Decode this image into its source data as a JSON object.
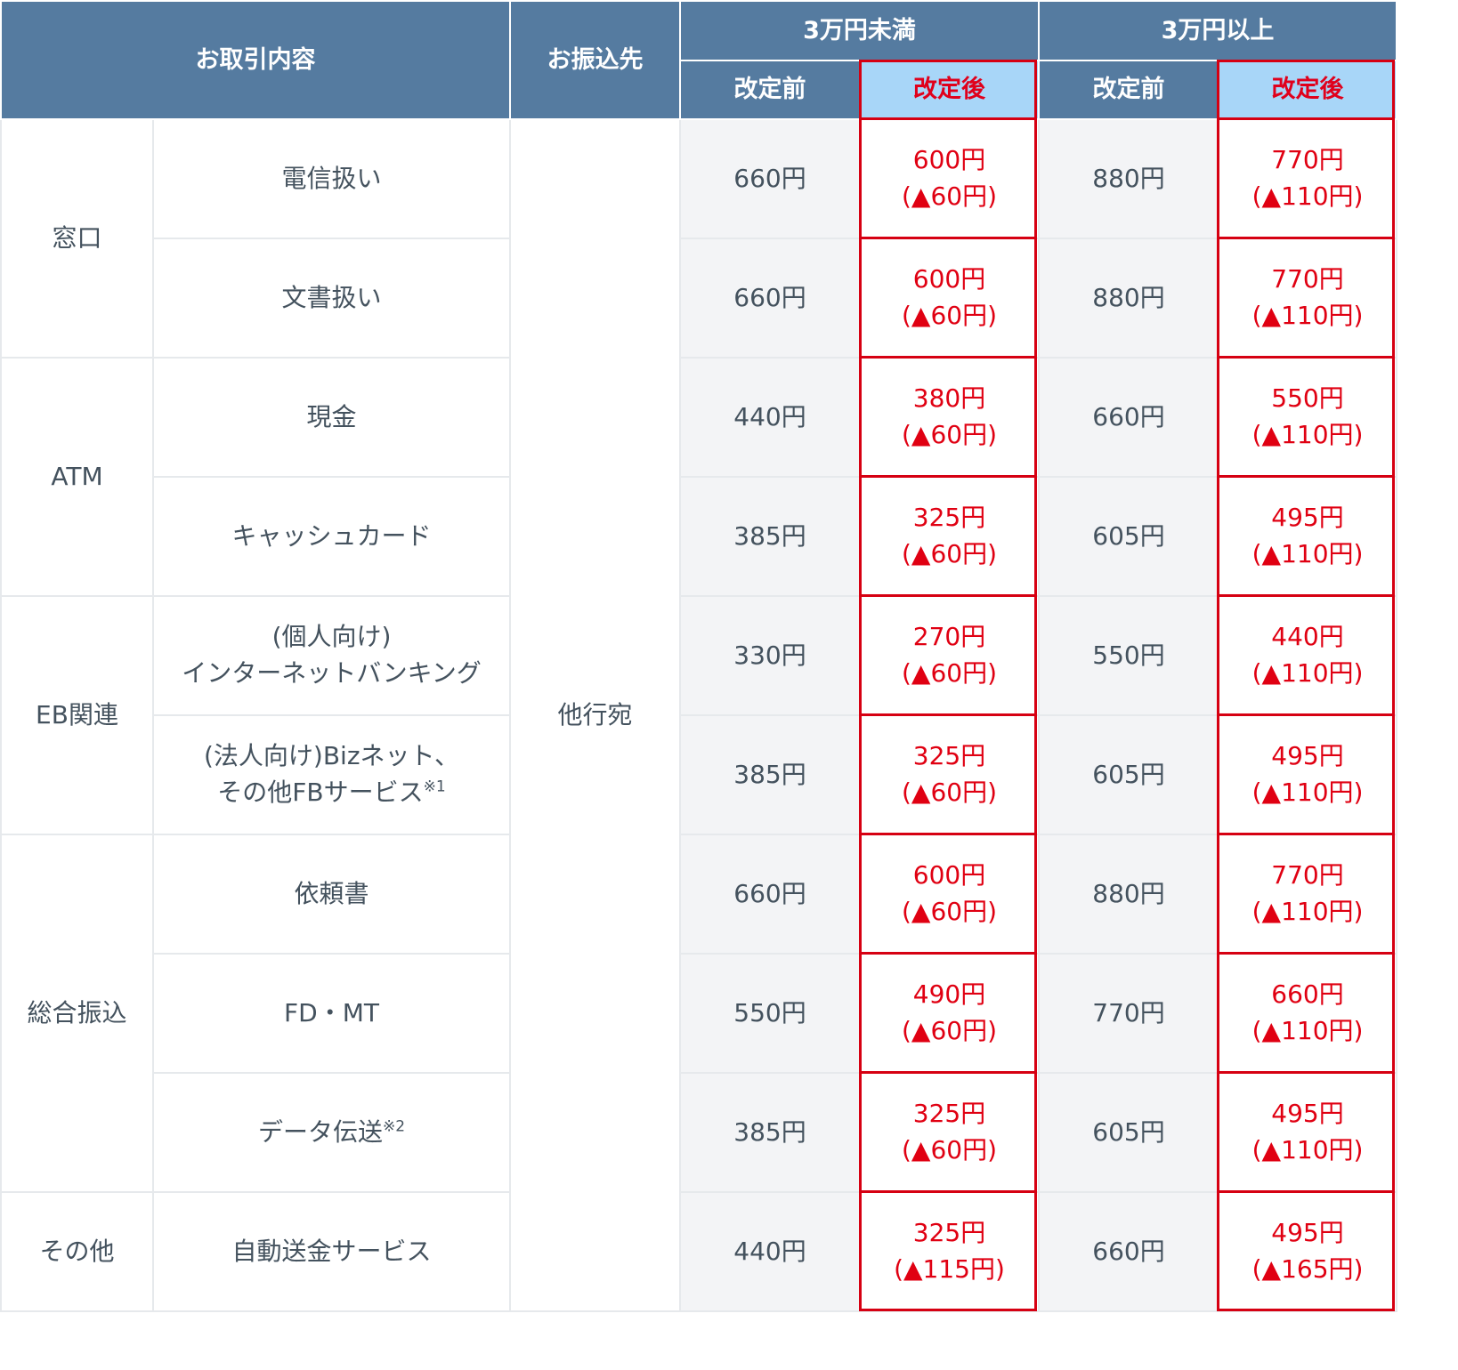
{
  "header": {
    "transaction": "お取引内容",
    "destination": "お振込先",
    "under_30k": "3万円未満",
    "over_30k": "3万円以上",
    "before": "改定前",
    "after": "改定後"
  },
  "destination_value": "他行宛",
  "categories": [
    "窓口",
    "ATM",
    "EB関連",
    "総合振込",
    "その他"
  ],
  "rows": [
    {
      "item": [
        "電信扱い"
      ],
      "note": "",
      "u_before": "660円",
      "u_after": "600円",
      "u_diff": "(▲60円)",
      "o_before": "880円",
      "o_after": "770円",
      "o_diff": "(▲110円)"
    },
    {
      "item": [
        "文書扱い"
      ],
      "note": "",
      "u_before": "660円",
      "u_after": "600円",
      "u_diff": "(▲60円)",
      "o_before": "880円",
      "o_after": "770円",
      "o_diff": "(▲110円)"
    },
    {
      "item": [
        "現金"
      ],
      "note": "",
      "u_before": "440円",
      "u_after": "380円",
      "u_diff": "(▲60円)",
      "o_before": "660円",
      "o_after": "550円",
      "o_diff": "(▲110円)"
    },
    {
      "item": [
        "キャッシュカード"
      ],
      "note": "",
      "u_before": "385円",
      "u_after": "325円",
      "u_diff": "(▲60円)",
      "o_before": "605円",
      "o_after": "495円",
      "o_diff": "(▲110円)"
    },
    {
      "item": [
        "(個人向け)",
        "インターネットバンキング"
      ],
      "note": "",
      "u_before": "330円",
      "u_after": "270円",
      "u_diff": "(▲60円)",
      "o_before": "550円",
      "o_after": "440円",
      "o_diff": "(▲110円)"
    },
    {
      "item": [
        "(法人向け)Bizネット、",
        "その他FBサービス"
      ],
      "note": "※1",
      "u_before": "385円",
      "u_after": "325円",
      "u_diff": "(▲60円)",
      "o_before": "605円",
      "o_after": "495円",
      "o_diff": "(▲110円)"
    },
    {
      "item": [
        "依頼書"
      ],
      "note": "",
      "u_before": "660円",
      "u_after": "600円",
      "u_diff": "(▲60円)",
      "o_before": "880円",
      "o_after": "770円",
      "o_diff": "(▲110円)"
    },
    {
      "item": [
        "FD・MT"
      ],
      "note": "",
      "u_before": "550円",
      "u_after": "490円",
      "u_diff": "(▲60円)",
      "o_before": "770円",
      "o_after": "660円",
      "o_diff": "(▲110円)"
    },
    {
      "item": [
        "データ伝送"
      ],
      "note": "※2",
      "u_before": "385円",
      "u_after": "325円",
      "u_diff": "(▲60円)",
      "o_before": "605円",
      "o_after": "495円",
      "o_diff": "(▲110円)"
    },
    {
      "item": [
        "自動送金サービス"
      ],
      "note": "",
      "u_before": "440円",
      "u_after": "325円",
      "u_diff": "(▲115円)",
      "o_before": "660円",
      "o_after": "495円",
      "o_diff": "(▲165円)"
    }
  ],
  "colors": {
    "header_bg": "#557ba0",
    "header_highlight_bg": "#a8d6f8",
    "accent_red": "#e00012",
    "before_bg": "#f3f4f6",
    "text": "#44525e"
  }
}
